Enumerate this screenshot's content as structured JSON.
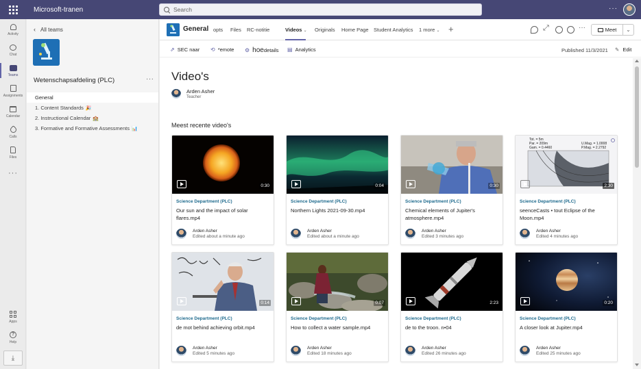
{
  "app": {
    "title": "Microsoft-tranen",
    "search_placeholder": "Search"
  },
  "rail": {
    "items": [
      {
        "label": "Activity",
        "icon": "bell-icon"
      },
      {
        "label": "Chat",
        "icon": "chat-icon"
      },
      {
        "label": "Teams",
        "icon": "teams-icon"
      },
      {
        "label": "Assignments",
        "icon": "assignments-icon"
      },
      {
        "label": "Calendar",
        "icon": "calendar-icon"
      },
      {
        "label": "Calls",
        "icon": "phone-icon"
      },
      {
        "label": "Files",
        "icon": "file-icon"
      },
      {
        "label": "",
        "icon": "more-apps-icon"
      },
      {
        "label": "Apps",
        "icon": "apps-icon"
      },
      {
        "label": "Help",
        "icon": "help-icon"
      }
    ]
  },
  "team": {
    "back_label": "All teams",
    "name": "Wetenschapsafdeling (PLC)",
    "channels": [
      {
        "label": "General",
        "emoji": ""
      },
      {
        "label": "1. Content Standards",
        "emoji": "🎉"
      },
      {
        "label": "2. Instructional Calendar",
        "emoji": "🏫"
      },
      {
        "label": "3. Formative and Formative Assessments",
        "emoji": "📊"
      }
    ]
  },
  "header": {
    "channel": "General",
    "tabs": [
      "opts",
      "Files",
      "RC-notitie",
      "Videos",
      "Originals",
      "Home Page",
      "Student Analytics",
      "1 more"
    ],
    "active_tab": "Videos",
    "meet_label": "Meet"
  },
  "commands": {
    "items": [
      "SEC naar",
      "*emote",
      "hoe",
      "details",
      "Analytics"
    ],
    "published": "Published 11/3/2021",
    "edit": "Edit"
  },
  "page": {
    "title": "Video's",
    "author_name": "Arden Asher",
    "author_role": "Teacher",
    "section_title": "Meest recente video's"
  },
  "videos": [
    {
      "dept": "Science Department (PLC)",
      "title": "Our sun and the impact of solar flares.mp4",
      "author": "Arden Asher",
      "time": "Edited about a minute ago",
      "duration": "0:30",
      "thumb": "sun"
    },
    {
      "dept": "Science Department (PLC)",
      "title": "Northern Lights 2021-09-30.mp4",
      "author": "Arden Asher",
      "time": "Edited about a minute ago",
      "duration": "0:04",
      "thumb": "aurora"
    },
    {
      "dept": "Science Department (PLC)",
      "title": "Chemical elements of Jupiter's atmosphere.mp4",
      "author": "Arden Asher",
      "time": "Edited 3 minutes ago",
      "duration": "0:30",
      "thumb": "chemistry"
    },
    {
      "dept": "Science Department (PLC)",
      "title": "seenceCasts • tout    Eclipse of the Moon.mp4",
      "author": "Arden Asher",
      "time": "Edited 4 minutes ago",
      "duration": "2:30",
      "thumb": "eclipse",
      "eclipse_text": [
        "Tot. = 5m",
        "Par. = 209m",
        "Gam. = 0.4460",
        "U.Mag. = 1.0008",
        "P.Mag. = 2.2792"
      ]
    },
    {
      "dept": "Science Department (PLC)",
      "title": "de mot     behind achieving orbit.mp4",
      "author": "Arden Asher",
      "time": "Edited 5 minutes ago",
      "duration": "0:14",
      "thumb": "lecture"
    },
    {
      "dept": "Science Department (PLC)",
      "title": "How to collect a water sample.mp4",
      "author": "Arden Asher",
      "time": "Edited 18 minutes ago",
      "duration": "0:07",
      "thumb": "stream"
    },
    {
      "dept": "Science Department (PLC)",
      "title": "de to the troon. n•04",
      "author": "Arden Asher",
      "time": "Edited 26 minutes ago",
      "duration": "2:23",
      "thumb": "rocket"
    },
    {
      "dept": "Science Department (PLC)",
      "title": "A closer look at Jupiter.mp4",
      "author": "Arden Asher",
      "time": "Edited 25 minutes ago",
      "duration": "0:20",
      "thumb": "jupiter"
    }
  ],
  "colors": {
    "titlebar": "#464775",
    "accent": "#6264a7",
    "dept": "#1e6a8d"
  }
}
